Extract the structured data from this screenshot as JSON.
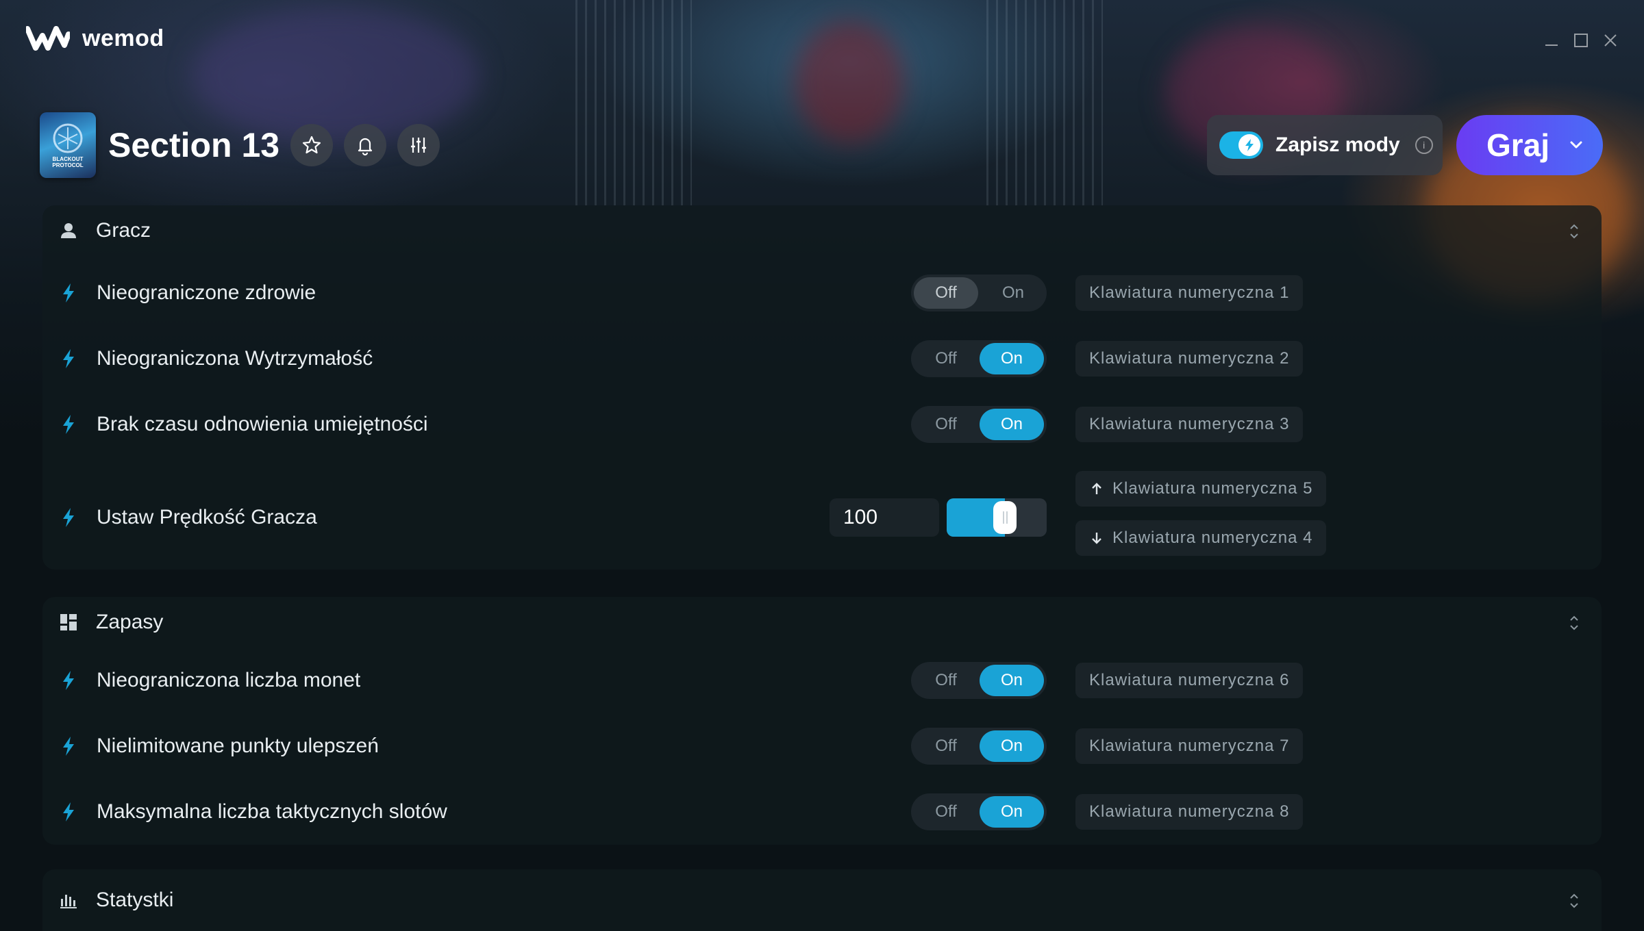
{
  "app": {
    "name": "wemod"
  },
  "game": {
    "title": "Section 13",
    "cover_text": "BLACKOUT PROTOCOL"
  },
  "header": {
    "save_mods_label": "Zapisz mody",
    "save_mods_info": "i",
    "play_label": "Graj"
  },
  "sections": {
    "player": {
      "title": "Gracz",
      "rows": [
        {
          "label": "Nieograniczone zdrowie",
          "state": "Off",
          "off": "Off",
          "on": "On",
          "hotkey": "Klawiatura numeryczna 1"
        },
        {
          "label": "Nieograniczona Wytrzymałość",
          "state": "On",
          "off": "Off",
          "on": "On",
          "hotkey": "Klawiatura numeryczna 2"
        },
        {
          "label": "Brak czasu odnowienia umiejętności",
          "state": "On",
          "off": "Off",
          "on": "On",
          "hotkey": "Klawiatura numeryczna 3"
        }
      ],
      "speed": {
        "label": "Ustaw Prędkość Gracza",
        "value": "100",
        "slider_fraction": 0.5,
        "hotkey_up": "Klawiatura numeryczna 5",
        "hotkey_down": "Klawiatura numeryczna 4"
      }
    },
    "supplies": {
      "title": "Zapasy",
      "rows": [
        {
          "label": "Nieograniczona liczba monet",
          "state": "On",
          "off": "Off",
          "on": "On",
          "hotkey": "Klawiatura numeryczna 6"
        },
        {
          "label": "Nielimitowane punkty ulepszeń",
          "state": "On",
          "off": "Off",
          "on": "On",
          "hotkey": "Klawiatura numeryczna 7"
        },
        {
          "label": "Maksymalna liczba taktycznych slotów",
          "state": "On",
          "off": "Off",
          "on": "On",
          "hotkey": "Klawiatura numeryczna 8"
        }
      ]
    },
    "stats": {
      "title": "Statystki"
    }
  },
  "colors": {
    "accent": "#1aa3d6",
    "play_gradient_start": "#6a3cf2",
    "play_gradient_end": "#4a6cf7"
  }
}
